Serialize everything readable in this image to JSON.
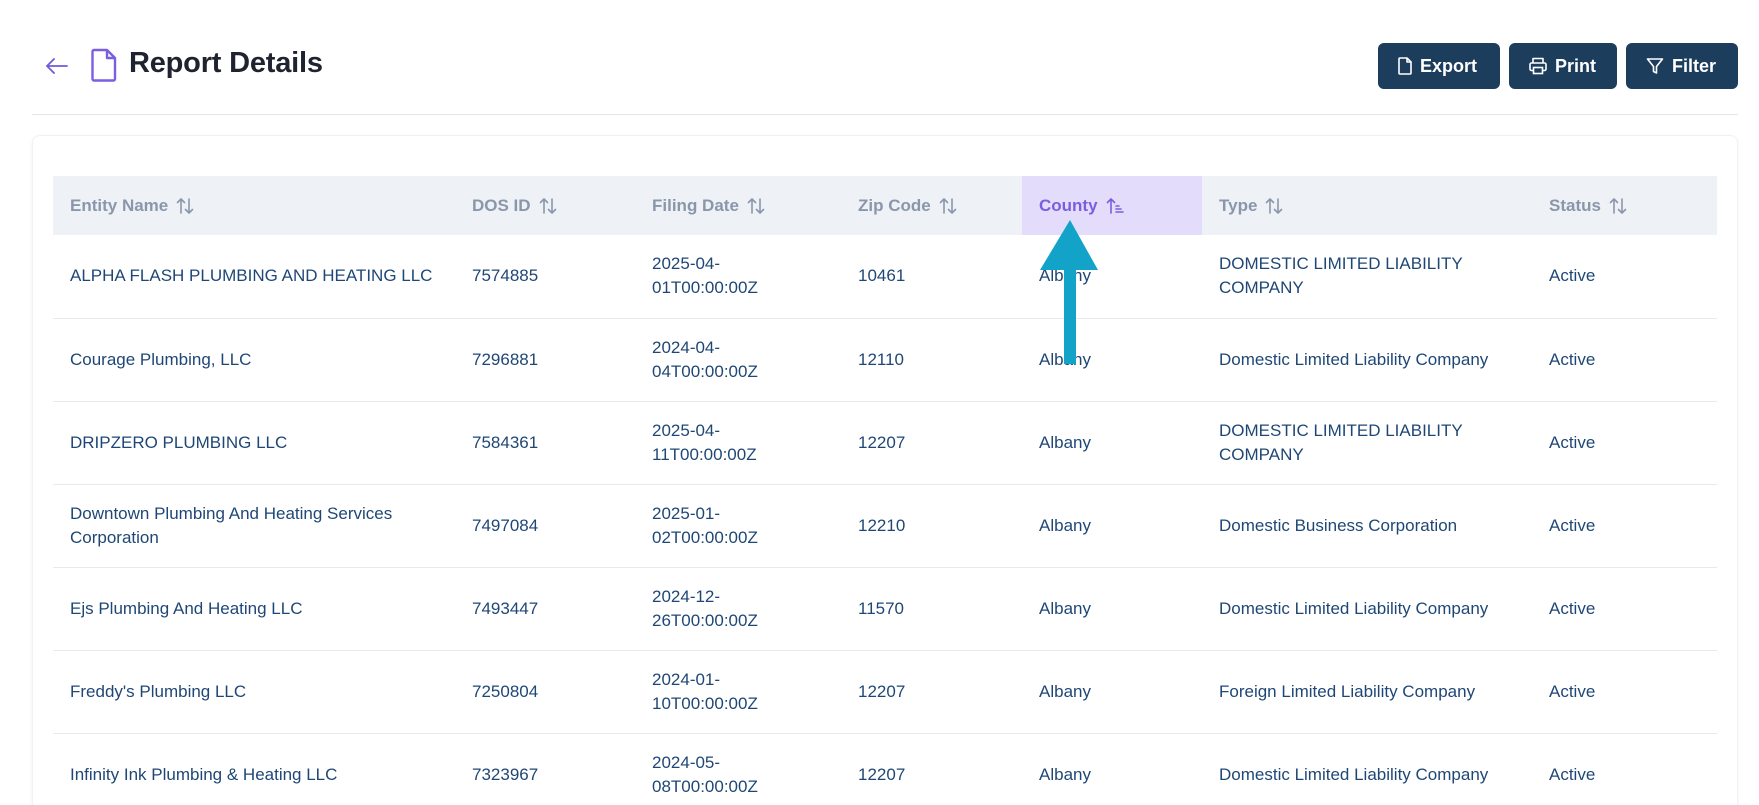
{
  "header": {
    "title": "Report Details",
    "back_icon": "arrow-left-icon",
    "doc_icon": "document-icon"
  },
  "actions": {
    "export_label": "Export",
    "print_label": "Print",
    "filter_label": "Filter"
  },
  "table": {
    "columns": [
      "Entity Name",
      "DOS ID",
      "Filing Date",
      "Zip Code",
      "County",
      "Type",
      "Status"
    ],
    "sorted_column": "County",
    "rows": [
      {
        "entity": "ALPHA FLASH PLUMBING AND HEATING LLC",
        "dos_id": "7574885",
        "filing_date": "2025-04-01T00:00:00Z",
        "zip": "10461",
        "county": "Albany",
        "type": "DOMESTIC LIMITED LIABILITY COMPANY",
        "status": "Active"
      },
      {
        "entity": "Courage Plumbing, LLC",
        "dos_id": "7296881",
        "filing_date": "2024-04-04T00:00:00Z",
        "zip": "12110",
        "county": "Albany",
        "type": "Domestic Limited Liability Company",
        "status": "Active"
      },
      {
        "entity": "DRIPZERO PLUMBING LLC",
        "dos_id": "7584361",
        "filing_date": "2025-04-11T00:00:00Z",
        "zip": "12207",
        "county": "Albany",
        "type": "DOMESTIC LIMITED LIABILITY COMPANY",
        "status": "Active"
      },
      {
        "entity": "Downtown Plumbing And Heating Services Corporation",
        "dos_id": "7497084",
        "filing_date": "2025-01-02T00:00:00Z",
        "zip": "12210",
        "county": "Albany",
        "type": "Domestic Business Corporation",
        "status": "Active"
      },
      {
        "entity": "Ejs Plumbing And Heating LLC",
        "dos_id": "7493447",
        "filing_date": "2024-12-26T00:00:00Z",
        "zip": "11570",
        "county": "Albany",
        "type": "Domestic Limited Liability Company",
        "status": "Active"
      },
      {
        "entity": "Freddy's Plumbing LLC",
        "dos_id": "7250804",
        "filing_date": "2024-01-10T00:00:00Z",
        "zip": "12207",
        "county": "Albany",
        "type": "Foreign Limited Liability Company",
        "status": "Active"
      },
      {
        "entity": "Infinity Ink Plumbing & Heating LLC",
        "dos_id": "7323967",
        "filing_date": "2024-05-08T00:00:00Z",
        "zip": "12207",
        "county": "Albany",
        "type": "Domestic Limited Liability Company",
        "status": "Active"
      }
    ]
  },
  "colors": {
    "primary_button": "#1d3d5c",
    "accent": "#7b5ee0",
    "annotation_arrow": "#13a3c9"
  }
}
